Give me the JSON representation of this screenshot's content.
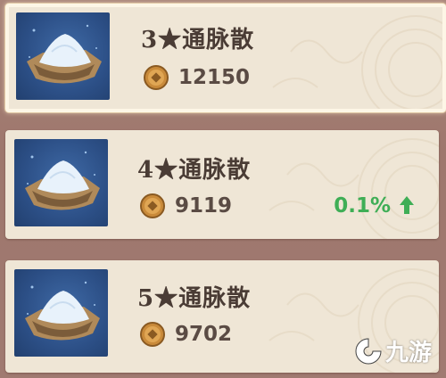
{
  "items": [
    {
      "name": "3★通脉散",
      "price": "12150",
      "change": "",
      "selected": true
    },
    {
      "name": "4★通脉散",
      "price": "9119",
      "change": "0.1%",
      "selected": false
    },
    {
      "name": "5★通脉散",
      "price": "9702",
      "change": "",
      "selected": false
    }
  ],
  "watermark": {
    "text": "九游"
  },
  "icons": {
    "item": "powder-bowl-icon",
    "currency": "coin-icon",
    "trend": "up-arrow-icon",
    "brand": "jiuyou-logo-icon"
  },
  "colors": {
    "card": "#efe6d6",
    "text": "#4a3c35",
    "up": "#3fae56",
    "background": "#a98479"
  }
}
